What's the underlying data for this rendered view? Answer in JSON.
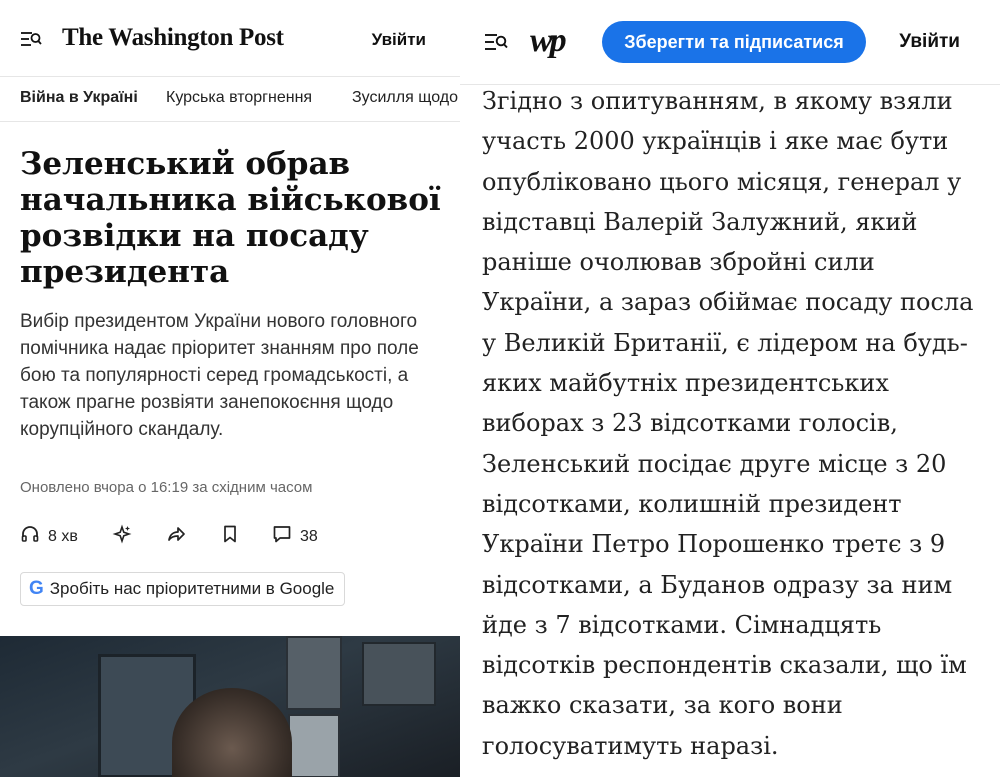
{
  "left": {
    "brand": "The Washington Post",
    "login": "Увійти",
    "sections": [
      "Війна в Україні",
      "Курська вторгнення",
      "Зусилля щодо"
    ],
    "headline": "Зеленський обрав начальника військової розвідки на посаду президента",
    "dek": "Вибір президентом України нового головного помічника надає пріоритет знанням про поле бою та популярності серед громадськості, а також прагне розвіяти занепокоєння щодо корупційного скандалу.",
    "updated": "Оновлено вчора о 16:19 за східним часом",
    "actions": {
      "listen_label": "8 хв",
      "comments_count": "38"
    },
    "google_button": {
      "logo": "G",
      "label": "Зробіть нас пріоритетними в Google"
    }
  },
  "right": {
    "brand_monogram": "wp",
    "subscribe_label": "Зберегти та підписатися",
    "login": "Увійти",
    "body_lines": [
      "Згідно з опитуванням, в якому взяли",
      "участь 2000 українців і яке має бути",
      "опубліковано цього місяця, генерал у",
      "відставці Валерій Залужний, який",
      "раніше очолював збройні сили",
      "України, а зараз обіймає посаду посла",
      "у Великій Британії, є лідером на будь-",
      "яких майбутніх президентських",
      "виборах з 23 відсотками голосів,",
      "Зеленський посідає друге місце з 20",
      "відсотками, колишній президент",
      "України Петро Порошенко третє з 9",
      "відсотками, а Буданов одразу за ним",
      "йде з 7 відсотками. Сімнадцять",
      "відсотків респондентів сказали, що їм",
      "важко сказати, за кого вони",
      "голосуватимуть наразі."
    ]
  }
}
